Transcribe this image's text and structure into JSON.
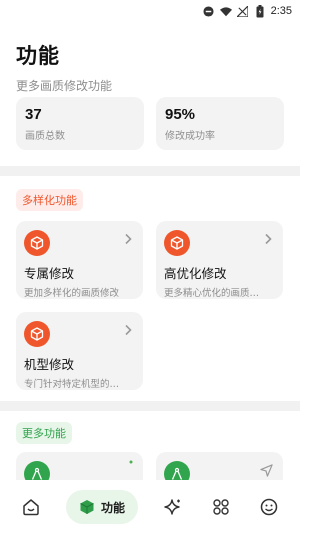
{
  "status_bar": {
    "time": "2:35"
  },
  "header": {
    "title": "功能",
    "subtitle": "更多画质修改功能"
  },
  "stats": [
    {
      "value": "37",
      "label": "画质总数"
    },
    {
      "value": "95%",
      "label": "修改成功率"
    }
  ],
  "sections": {
    "diverse": {
      "label": "多样化功能"
    },
    "more": {
      "label": "更多功能"
    }
  },
  "cards": [
    {
      "title": "专属修改",
      "desc": "更加多样化的画质修改"
    },
    {
      "title": "高优化修改",
      "desc": "更多精心优化的画质…"
    },
    {
      "title": "机型修改",
      "desc": "专门针对特定机型的…"
    }
  ],
  "bottom_nav": {
    "active_label": "功能"
  },
  "colors": {
    "accent_orange": "#f0562c",
    "accent_green": "#31a54d"
  }
}
